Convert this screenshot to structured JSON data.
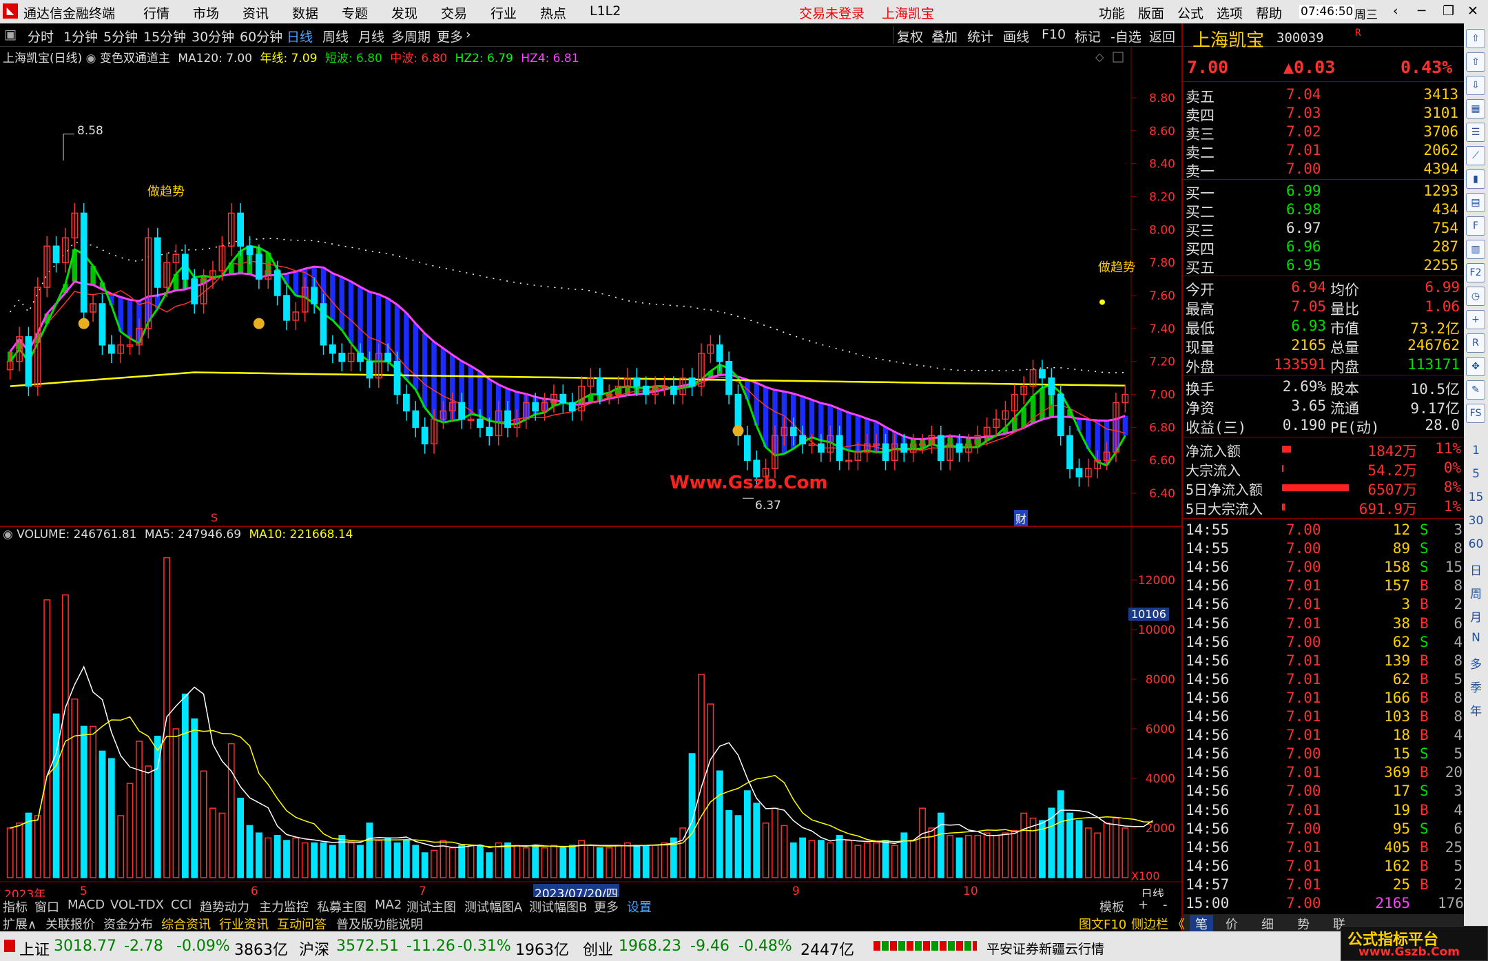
{
  "titlebar": {
    "app_name": "通达信金融终端",
    "menu": [
      "行情",
      "市场",
      "资讯",
      "数据",
      "专题",
      "发现",
      "交易",
      "行业",
      "热点",
      "L1L2"
    ],
    "login": "交易未登录",
    "stock": "上海凯宝",
    "right_menu": [
      "功能",
      "版面",
      "公式",
      "选项",
      "帮助"
    ],
    "time": "07:46:50",
    "weekday": "周三"
  },
  "toolbar": {
    "periods": [
      "分时",
      "1分钟",
      "5分钟",
      "15分钟",
      "30分钟",
      "60分钟",
      "日线",
      "周线",
      "月线",
      "多周期",
      "更多"
    ],
    "active": "日线",
    "tools": [
      "复权",
      "叠加",
      "统计",
      "画线",
      "F10",
      "标记",
      "-自选",
      "返回"
    ]
  },
  "chart_header": {
    "name": "上海凯宝(日线)",
    "indicator": "变色双通道主",
    "ma120": "MA120: 7.00",
    "year": "年线: 7.09",
    "short": "短波: 6.80",
    "mid": "中波: 6.80",
    "hz2": "HZ2: 6.79",
    "hz4": "HZ4: 6.81"
  },
  "vol_header": {
    "volume": "VOLUME: 246761.81",
    "ma5": "MA5: 247946.69",
    "ma10": "MA10: 221668.14"
  },
  "annotations": {
    "high": "8.58",
    "low": "6.37",
    "trend1": "做趋势",
    "trend2": "做趋势",
    "watermark": "Www.Gszb.Com",
    "s_mark": "S",
    "cai_mark": "财",
    "vol_cursor": "10106",
    "x100": "X100"
  },
  "price_axis": [
    "8.80",
    "8.60",
    "8.40",
    "8.20",
    "8.00",
    "7.80",
    "7.60",
    "7.40",
    "7.20",
    "7.00",
    "6.80",
    "6.60",
    "6.40"
  ],
  "vol_axis": [
    "12000",
    "10000",
    "8000",
    "6000",
    "4000",
    "2000"
  ],
  "date_axis": {
    "year": "2023年",
    "m5": "5",
    "m6": "6",
    "m7": "7",
    "cursor": "2023/07/20/四",
    "m9": "9",
    "m10": "10",
    "period": "日线"
  },
  "chart_data": {
    "type": "candlestick",
    "ylim": [
      6.3,
      8.9
    ],
    "vol_ylim": [
      0,
      13500
    ],
    "closes": [
      7.2,
      7.35,
      7.05,
      7.65,
      7.9,
      7.8,
      7.95,
      8.1,
      7.5,
      7.55,
      7.3,
      7.25,
      7.3,
      7.3,
      7.4,
      7.95,
      7.65,
      7.8,
      7.85,
      7.7,
      7.55,
      7.7,
      7.75,
      7.9,
      8.1,
      7.9,
      7.85,
      7.7,
      7.75,
      7.6,
      7.45,
      7.5,
      7.65,
      7.55,
      7.3,
      7.25,
      7.2,
      7.25,
      7.2,
      7.1,
      7.25,
      7.2,
      7.0,
      6.9,
      6.8,
      6.7,
      6.85,
      6.9,
      6.95,
      6.85,
      6.85,
      6.8,
      6.75,
      6.9,
      6.8,
      6.85,
      6.95,
      6.9,
      6.95,
      7.0,
      6.95,
      6.9,
      7.05,
      7.1,
      7.0,
      7.0,
      7.05,
      7.1,
      7.05,
      7.0,
      7.05,
      7.05,
      7.0,
      7.1,
      7.05,
      7.25,
      7.3,
      7.2,
      7.0,
      6.75,
      6.6,
      6.5,
      6.55,
      6.75,
      6.8,
      6.75,
      6.7,
      6.7,
      6.65,
      6.75,
      6.6,
      6.6,
      6.65,
      6.7,
      6.7,
      6.6,
      6.7,
      6.65,
      6.7,
      6.7,
      6.75,
      6.6,
      6.7,
      6.65,
      6.7,
      6.75,
      6.8,
      6.85,
      6.9,
      7.0,
      7.05,
      7.15,
      7.1,
      7.0,
      6.75,
      6.55,
      6.5,
      6.55,
      6.6,
      6.65,
      6.95,
      7.0
    ],
    "volumes": [
      2000,
      2200,
      2600,
      2500,
      11200,
      6600,
      11400,
      7200,
      6100,
      6100,
      5100,
      4800,
      2500,
      3800,
      5500,
      4500,
      5700,
      12900,
      6000,
      7400,
      6400,
      4300,
      2800,
      2600,
      5400,
      3200,
      2100,
      1800,
      1600,
      1700,
      1500,
      1600,
      1400,
      1400,
      1400,
      1300,
      1700,
      1400,
      1300,
      2200,
      1500,
      1600,
      1400,
      1500,
      1300,
      1000,
      1100,
      1500,
      1200,
      1300,
      1300,
      1300,
      1000,
      1400,
      1400,
      1300,
      1200,
      1300,
      1200,
      1300,
      1200,
      1300,
      1500,
      1300,
      1200,
      1200,
      1300,
      1400,
      1300,
      1300,
      1300,
      1400,
      1600,
      2000,
      5000,
      8200,
      7000,
      4300,
      2700,
      2500,
      3500,
      3000,
      2200,
      2800,
      2100,
      1400,
      1600,
      1500,
      1500,
      1400,
      1700,
      1500,
      1300,
      1400,
      1400,
      1500,
      1300,
      1800,
      1500,
      2800,
      2000,
      2600,
      1700,
      1600,
      1700,
      1700,
      1800,
      1700,
      1800,
      1900,
      2600,
      2400,
      2300,
      2800,
      3500,
      2600,
      2300,
      2000,
      1800,
      2200,
      2400,
      2000,
      1900,
      1800,
      3400
    ]
  },
  "quote": {
    "name": "上海凯宝",
    "code": "300039",
    "flag": "R",
    "price": "7.00",
    "change": "▲0.03",
    "pct": "0.43%",
    "asks": [
      {
        "label": "卖五",
        "price": "7.04",
        "vol": "3413"
      },
      {
        "label": "卖四",
        "price": "7.03",
        "vol": "3101"
      },
      {
        "label": "卖三",
        "price": "7.02",
        "vol": "3706"
      },
      {
        "label": "卖二",
        "price": "7.01",
        "vol": "2062"
      },
      {
        "label": "卖一",
        "price": "7.00",
        "vol": "4394"
      }
    ],
    "bids": [
      {
        "label": "买一",
        "price": "6.99",
        "vol": "1293"
      },
      {
        "label": "买二",
        "price": "6.98",
        "vol": "434"
      },
      {
        "label": "买三",
        "price": "6.97",
        "vol": "754"
      },
      {
        "label": "买四",
        "price": "6.96",
        "vol": "287"
      },
      {
        "label": "买五",
        "price": "6.95",
        "vol": "2255"
      }
    ],
    "stats": [
      [
        "今开",
        "6.94",
        "均价",
        "6.99"
      ],
      [
        "最高",
        "7.05",
        "量比",
        "1.06"
      ],
      [
        "最低",
        "6.93",
        "市值",
        "73.2亿"
      ],
      [
        "现量",
        "2165",
        "总量",
        "246762"
      ],
      [
        "外盘",
        "133591",
        "内盘",
        "113171"
      ]
    ],
    "fund": [
      [
        "换手",
        "2.69%",
        "股本",
        "10.5亿"
      ],
      [
        "净资",
        "3.65",
        "流通",
        "9.17亿"
      ],
      [
        "收益(三)",
        "0.190",
        "PE(动)",
        "28.0"
      ]
    ],
    "flows": [
      [
        "净流入额",
        "1842万",
        "11%",
        0.12
      ],
      [
        "大宗流入",
        "54.2万",
        "0%",
        0.01
      ],
      [
        "5日净流入额",
        "6507万",
        "8%",
        0.9
      ],
      [
        "5日大宗流入",
        "691.9万",
        "1%",
        0.04
      ]
    ],
    "ticks": [
      [
        "14:55",
        "7.00",
        "12",
        "S",
        "3"
      ],
      [
        "14:55",
        "7.00",
        "89",
        "S",
        "8"
      ],
      [
        "14:56",
        "7.00",
        "158",
        "S",
        "15"
      ],
      [
        "14:56",
        "7.01",
        "157",
        "B",
        "8"
      ],
      [
        "14:56",
        "7.01",
        "3",
        "B",
        "2"
      ],
      [
        "14:56",
        "7.01",
        "38",
        "B",
        "6"
      ],
      [
        "14:56",
        "7.00",
        "62",
        "S",
        "4"
      ],
      [
        "14:56",
        "7.01",
        "139",
        "B",
        "8"
      ],
      [
        "14:56",
        "7.01",
        "62",
        "B",
        "5"
      ],
      [
        "14:56",
        "7.01",
        "166",
        "B",
        "8"
      ],
      [
        "14:56",
        "7.01",
        "103",
        "B",
        "8"
      ],
      [
        "14:56",
        "7.01",
        "18",
        "B",
        "4"
      ],
      [
        "14:56",
        "7.00",
        "15",
        "S",
        "5"
      ],
      [
        "14:56",
        "7.01",
        "369",
        "B",
        "20"
      ],
      [
        "14:56",
        "7.00",
        "17",
        "S",
        "3"
      ],
      [
        "14:56",
        "7.01",
        "19",
        "B",
        "4"
      ],
      [
        "14:56",
        "7.00",
        "95",
        "S",
        "6"
      ],
      [
        "14:56",
        "7.01",
        "405",
        "B",
        "25"
      ],
      [
        "14:56",
        "7.01",
        "162",
        "B",
        "5"
      ],
      [
        "14:57",
        "7.01",
        "25",
        "B",
        "2"
      ],
      [
        "15:00",
        "7.00",
        "2165",
        "",
        "176"
      ]
    ],
    "bottom_tabs": [
      "笔",
      "价",
      "细",
      "势",
      "联"
    ],
    "fenshi_label": "图文F10",
    "sidebar_label": "侧边栏 《"
  },
  "bottom_tabs": [
    "指标",
    "窗口",
    "MACD",
    "VOL-TDX",
    "CCI",
    "趋势动力",
    "主力监控",
    "私募主图",
    "MA2",
    "测试主图",
    "测试幅图A",
    "测试幅图B",
    "更多",
    "设置"
  ],
  "bottom_right": [
    "模板",
    "+",
    "-"
  ],
  "tabs2": [
    "扩展∧",
    "关联报价",
    "资金分布",
    "综合资讯",
    "行业资讯",
    "互动问答",
    "普及版功能说明"
  ],
  "status": {
    "sh_label": "上证",
    "sh_val": "3018.77",
    "sh_chg": "-2.78",
    "sh_pct": "-0.09%",
    "sh_amt": "3863亿",
    "sz_label": "沪深",
    "sz_val": "3572.51",
    "sz_chg": "-11.26",
    "sz_pct": "-0.31%",
    "sz_amt": "1963亿",
    "cy_label": "创业",
    "cy_val": "1968.23",
    "cy_chg": "-9.46",
    "cy_pct": "-0.48%",
    "cy_amt": "2447亿",
    "server": "平安证券新疆云行情",
    "brand": "公式指标平台",
    "brand_url": "www.Gszb.Com"
  },
  "icons": [
    "up-arrow-icon",
    "up-arrow-icon",
    "down-arrow-icon",
    "grid-icon",
    "list-icon",
    "line-chart-icon",
    "candle-icon",
    "text-icon",
    "f10-icon",
    "chart-icon",
    "f2-icon",
    "clock-icon",
    "plus-icon",
    "rsi-icon",
    "move-icon",
    "pen-icon",
    "fs-icon"
  ],
  "icon_labels": [
    "1",
    "5",
    "15",
    "30",
    "60",
    "日",
    "周",
    "月",
    "N",
    "多",
    "季",
    "年"
  ]
}
